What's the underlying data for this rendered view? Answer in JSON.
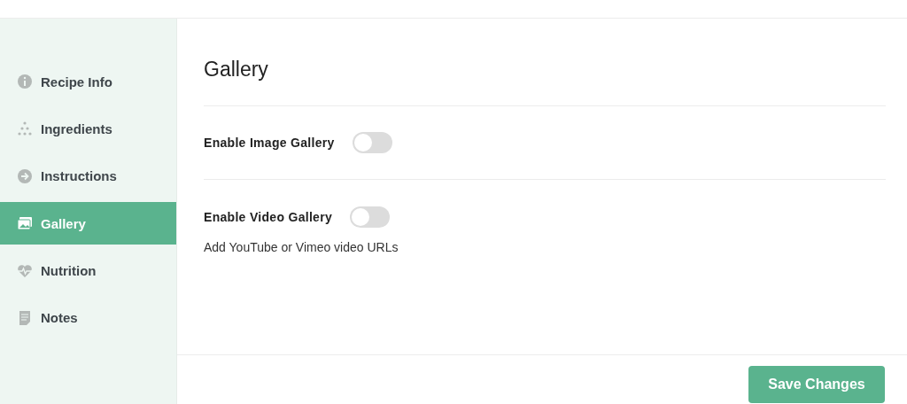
{
  "sidebar": {
    "items": [
      {
        "label": "Recipe Info",
        "selected": false
      },
      {
        "label": "Ingredients",
        "selected": false
      },
      {
        "label": "Instructions",
        "selected": false
      },
      {
        "label": "Gallery",
        "selected": true
      },
      {
        "label": "Nutrition",
        "selected": false
      },
      {
        "label": "Notes",
        "selected": false
      }
    ]
  },
  "main": {
    "title": "Gallery",
    "settings": [
      {
        "label": "Enable Image Gallery",
        "on": false
      },
      {
        "label": "Enable Video Gallery",
        "on": false,
        "help": "Add YouTube or Vimeo video URLs"
      }
    ]
  },
  "footer": {
    "button": "Save Changes"
  }
}
